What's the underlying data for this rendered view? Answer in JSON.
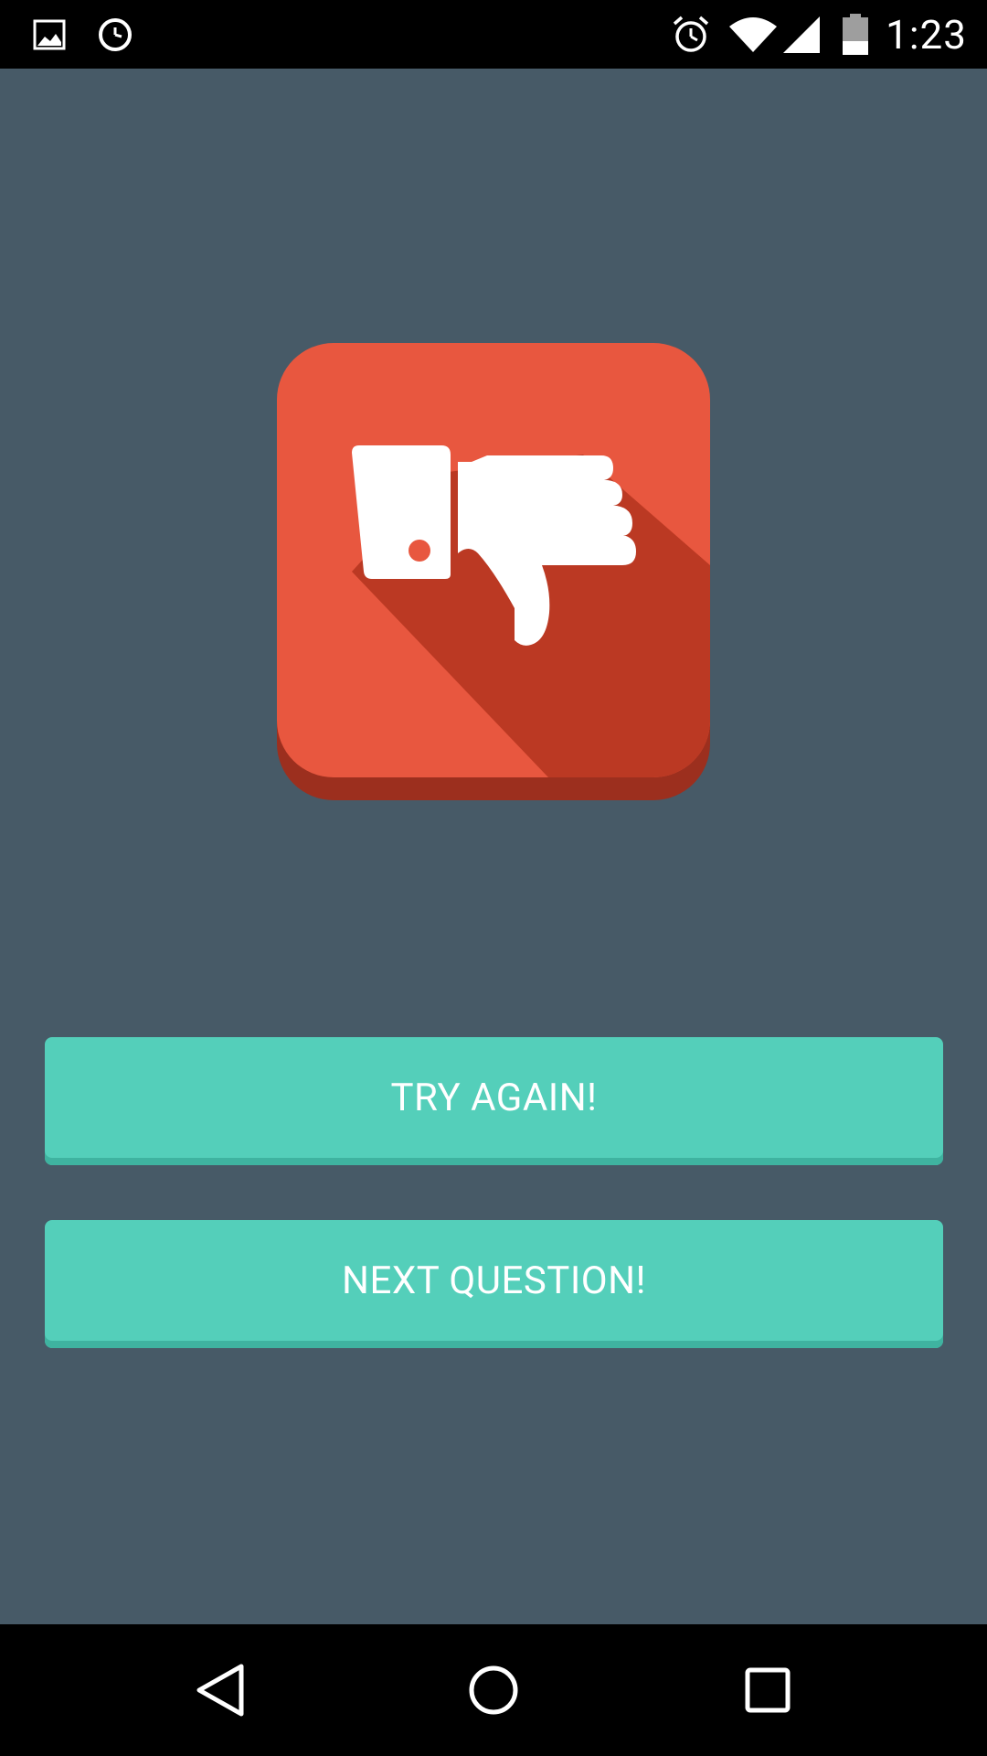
{
  "status_bar": {
    "time": "1:23",
    "left_icons": [
      "image-icon",
      "clock-icon"
    ],
    "right_icons": [
      "alarm-icon",
      "wifi-icon",
      "signal-icon",
      "battery-icon"
    ]
  },
  "result": {
    "icon": "thumbs-down-icon",
    "tile_color": "#e8573f",
    "shadow_color": "#bb3923"
  },
  "buttons": {
    "try_again": "TRY AGAIN!",
    "next_question": "NEXT QUESTION!",
    "color": "#54cfba"
  },
  "nav_bar": {
    "icons": [
      "back-icon",
      "home-icon",
      "recents-icon"
    ]
  },
  "colors": {
    "background": "#475a67"
  }
}
